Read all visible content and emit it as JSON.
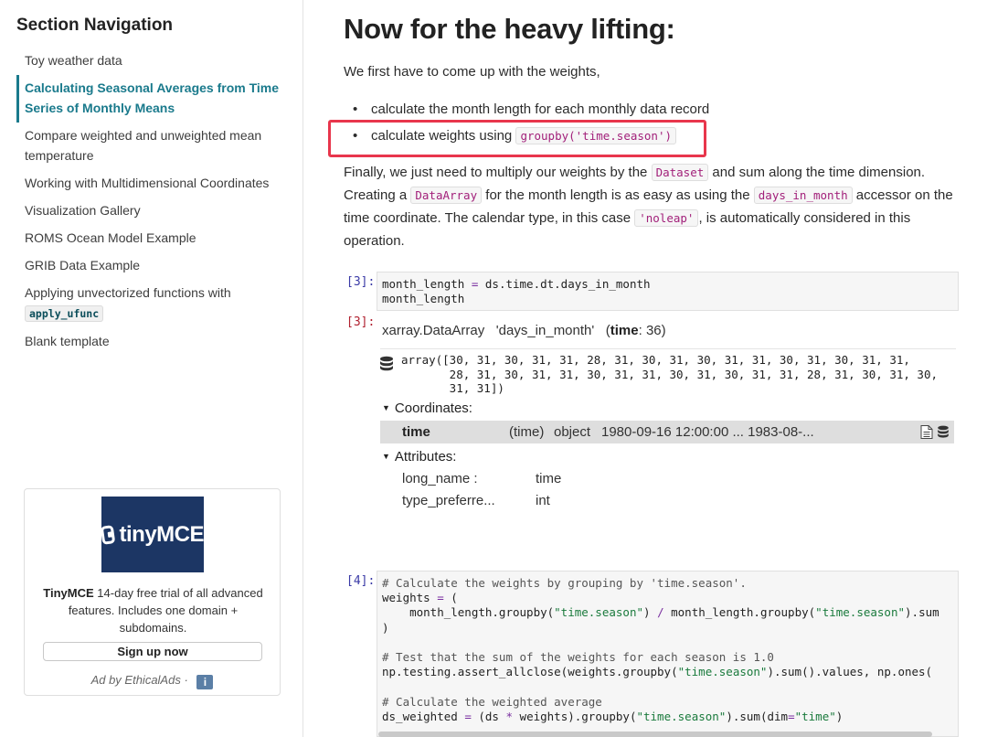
{
  "sidebar": {
    "title": "Section Navigation",
    "items": [
      {
        "label": "Toy weather data"
      },
      {
        "label": "Calculating Seasonal Averages from Time Series of Monthly Means"
      },
      {
        "label": "Compare weighted and unweighted mean temperature"
      },
      {
        "label": "Working with Multidimensional Coordinates"
      },
      {
        "label": "Visualization Gallery"
      },
      {
        "label": "ROMS Ocean Model Example"
      },
      {
        "label": "GRIB Data Example"
      },
      {
        "label": "Applying unvectorized functions with",
        "code": "apply_ufunc"
      },
      {
        "label": "Blank template"
      }
    ],
    "active_color": "#1a7a8c"
  },
  "ad": {
    "logo_text": "tinyMCE",
    "brand": "TinyMCE",
    "text": " 14-day free trial of all advanced features. Includes one domain + subdomains.",
    "button": "Sign up now",
    "footer": "Ad by EthicalAds",
    "footer_sep": "·",
    "info_icon": "i",
    "logo_bg": "#1c3664"
  },
  "main": {
    "title": "Now for the heavy lifting:",
    "intro": "We first have to come up with the weights,",
    "bullet1": "calculate the month length for each monthly data record",
    "bullet2_text": "calculate weights using ",
    "bullet2_code": "groupby('time.season')",
    "highlight_color": "#e8364c",
    "p2": {
      "t1": "Finally, we just need to multiply our weights by the ",
      "c1": "Dataset",
      "t2": " and sum along the time dimension. Creating a ",
      "c2": "DataArray",
      "t3": " for the month length is as easy as using the ",
      "c3": "days_in_month",
      "t4": " accessor on the time coordinate. The calendar type, in this case ",
      "c4": "'noleap'",
      "t5": ", is automatically considered in this operation."
    },
    "cell3": {
      "in_prompt": "[3]:",
      "out_prompt": "[3]:",
      "code_l1_a": "month_length ",
      "code_l1_op": "=",
      "code_l1_b": " ds.time.dt.days_in_month",
      "code_l2": "month_length"
    },
    "output": {
      "type": "xarray.DataArray",
      "name": "'days_in_month'",
      "dim_open": "(",
      "dim_name": "time",
      "dim_rest": ": 36)",
      "array_l1": "array([30, 31, 30, 31, 31, 28, 31, 30, 31, 30, 31, 31, 30, 31, 30, 31, 31,",
      "array_l2": "       28, 31, 30, 31, 31, 30, 31, 31, 30, 31, 30, 31, 31, 28, 31, 30, 31, 30,",
      "array_l3": "       31, 31])",
      "coords_label": "Coordinates:",
      "coord": {
        "name": "time",
        "dims": "(time)",
        "dtype": "object",
        "preview": "1980-09-16 12:00:00 ... 1983-08-..."
      },
      "attrs_label": "Attributes:",
      "attrs": [
        {
          "key": "long_name :",
          "value": "time"
        },
        {
          "key": "type_preferre...",
          "value": "int"
        }
      ]
    },
    "cell4": {
      "in_prompt": "[4]:",
      "l1": "# Calculate the weights by grouping by 'time.season'.",
      "l2a": "weights ",
      "l2op": "=",
      "l2b": " (",
      "l3a": "    month_length.groupby(",
      "l3s1": "\"time.season\"",
      "l3b": ") ",
      "l3op": "/",
      "l3c": " month_length.groupby(",
      "l3s2": "\"time.season\"",
      "l3d": ").sum",
      "l4": ")",
      "l6": "# Test that the sum of the weights for each season is 1.0",
      "l7a": "np.testing.assert_allclose(weights.groupby(",
      "l7s": "\"time.season\"",
      "l7b": ").sum().values, np.ones(",
      "l9": "# Calculate the weighted average",
      "l10a": "ds_weighted ",
      "l10op": "=",
      "l10b": " (ds ",
      "l10op2": "*",
      "l10c": " weights).groupby(",
      "l10s": "\"time.season\"",
      "l10d": ").sum(dim",
      "l10op3": "=",
      "l10s2": "\"time\"",
      "l10e": ")"
    }
  }
}
